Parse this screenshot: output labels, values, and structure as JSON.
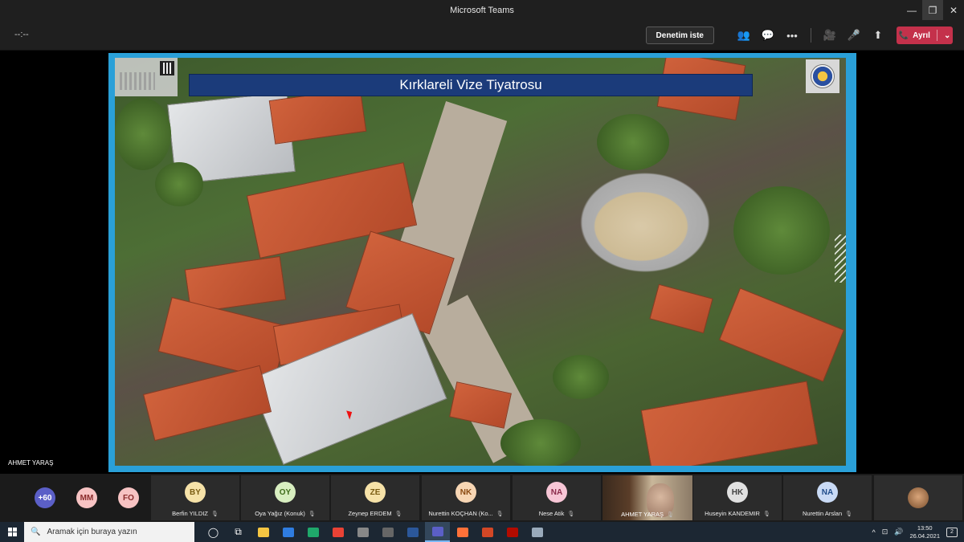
{
  "window": {
    "title": "Microsoft Teams",
    "minimize": "—",
    "maximize": "❐",
    "close": "✕"
  },
  "toolbar": {
    "timer": "--:--",
    "request_control_label": "Denetim iste",
    "participants_icon": "👥",
    "chat_icon": "💬",
    "more_icon": "•••",
    "camera_icon": "🎥",
    "mic_icon": "🎤",
    "share_icon": "⬆",
    "leave_label": "Ayrıl",
    "leave_icon": "📞",
    "leave_dropdown": "⌄"
  },
  "stage": {
    "presenter_name": "AHMET YARAŞ",
    "slide_title": "Kırklareli Vize Tiyatrosu"
  },
  "participants": {
    "overflow": {
      "label": "+60",
      "color": "#5b5fc7"
    },
    "bubbles": [
      {
        "initials": "MM",
        "bg": "#f7c3c3",
        "fg": "#8a2b2b"
      },
      {
        "initials": "FO",
        "bg": "#f7c3c3",
        "fg": "#8a2b2b"
      }
    ],
    "tiles": [
      {
        "initials": "BY",
        "name": "Berfin YILDIZ",
        "bg": "#f6e2a8",
        "fg": "#7a5c12"
      },
      {
        "initials": "OY",
        "name": "Oya Yağız (Konuk)",
        "bg": "#d8eec0",
        "fg": "#3f6b1a"
      },
      {
        "initials": "ZE",
        "name": "Zeynep ERDEM",
        "bg": "#f6e2a8",
        "fg": "#7a5c12"
      },
      {
        "initials": "NK",
        "name": "Nurettin KOÇHAN (Ko...",
        "bg": "#f7d6b4",
        "fg": "#8a4a12"
      },
      {
        "initials": "NA",
        "name": "Nese Atik",
        "bg": "#f7c6d6",
        "fg": "#8a2b4a"
      }
    ],
    "video_tile": {
      "name": "AHMET YARAŞ"
    },
    "tiles_right": [
      {
        "initials": "HK",
        "name": "Huseyin KANDEMIR",
        "bg": "#e1e1e1",
        "fg": "#444"
      },
      {
        "initials": "NA",
        "name": "Nurettin Arslan",
        "bg": "#c9daf5",
        "fg": "#1f4b8a"
      }
    ],
    "mic_glyph": "🎙"
  },
  "taskbar": {
    "search_placeholder": "Aramak için buraya yazın",
    "search_icon": "🔍",
    "apps": [
      {
        "name": "cortana-icon",
        "glyph": "◯",
        "color": "#fff"
      },
      {
        "name": "task-view-icon",
        "glyph": "⧉",
        "color": "#fff"
      },
      {
        "name": "file-explorer-icon",
        "glyph": "",
        "color": "#f4c542"
      },
      {
        "name": "mail-icon",
        "glyph": "",
        "color": "#2f7de1"
      },
      {
        "name": "edge-icon",
        "glyph": "",
        "color": "#1fa86b"
      },
      {
        "name": "chrome-icon",
        "glyph": "",
        "color": "#e94235"
      },
      {
        "name": "calculator-icon",
        "glyph": "",
        "color": "#888"
      },
      {
        "name": "camera-icon",
        "glyph": "",
        "color": "#666"
      },
      {
        "name": "word-icon",
        "glyph": "",
        "color": "#2b579a"
      },
      {
        "name": "teams-icon",
        "glyph": "",
        "color": "#5b5fc7",
        "active": true
      },
      {
        "name": "firefox-icon",
        "glyph": "",
        "color": "#ff7139"
      },
      {
        "name": "powerpoint-icon",
        "glyph": "",
        "color": "#d24726"
      },
      {
        "name": "acrobat-icon",
        "glyph": "",
        "color": "#b30b00"
      },
      {
        "name": "paint-icon",
        "glyph": "",
        "color": "#9ab"
      }
    ],
    "tray": {
      "chevron": "^",
      "net": "⊡",
      "vol": "🔊",
      "clock_time": "13:50",
      "clock_date": "26.04.2021",
      "notifications": "2"
    }
  }
}
